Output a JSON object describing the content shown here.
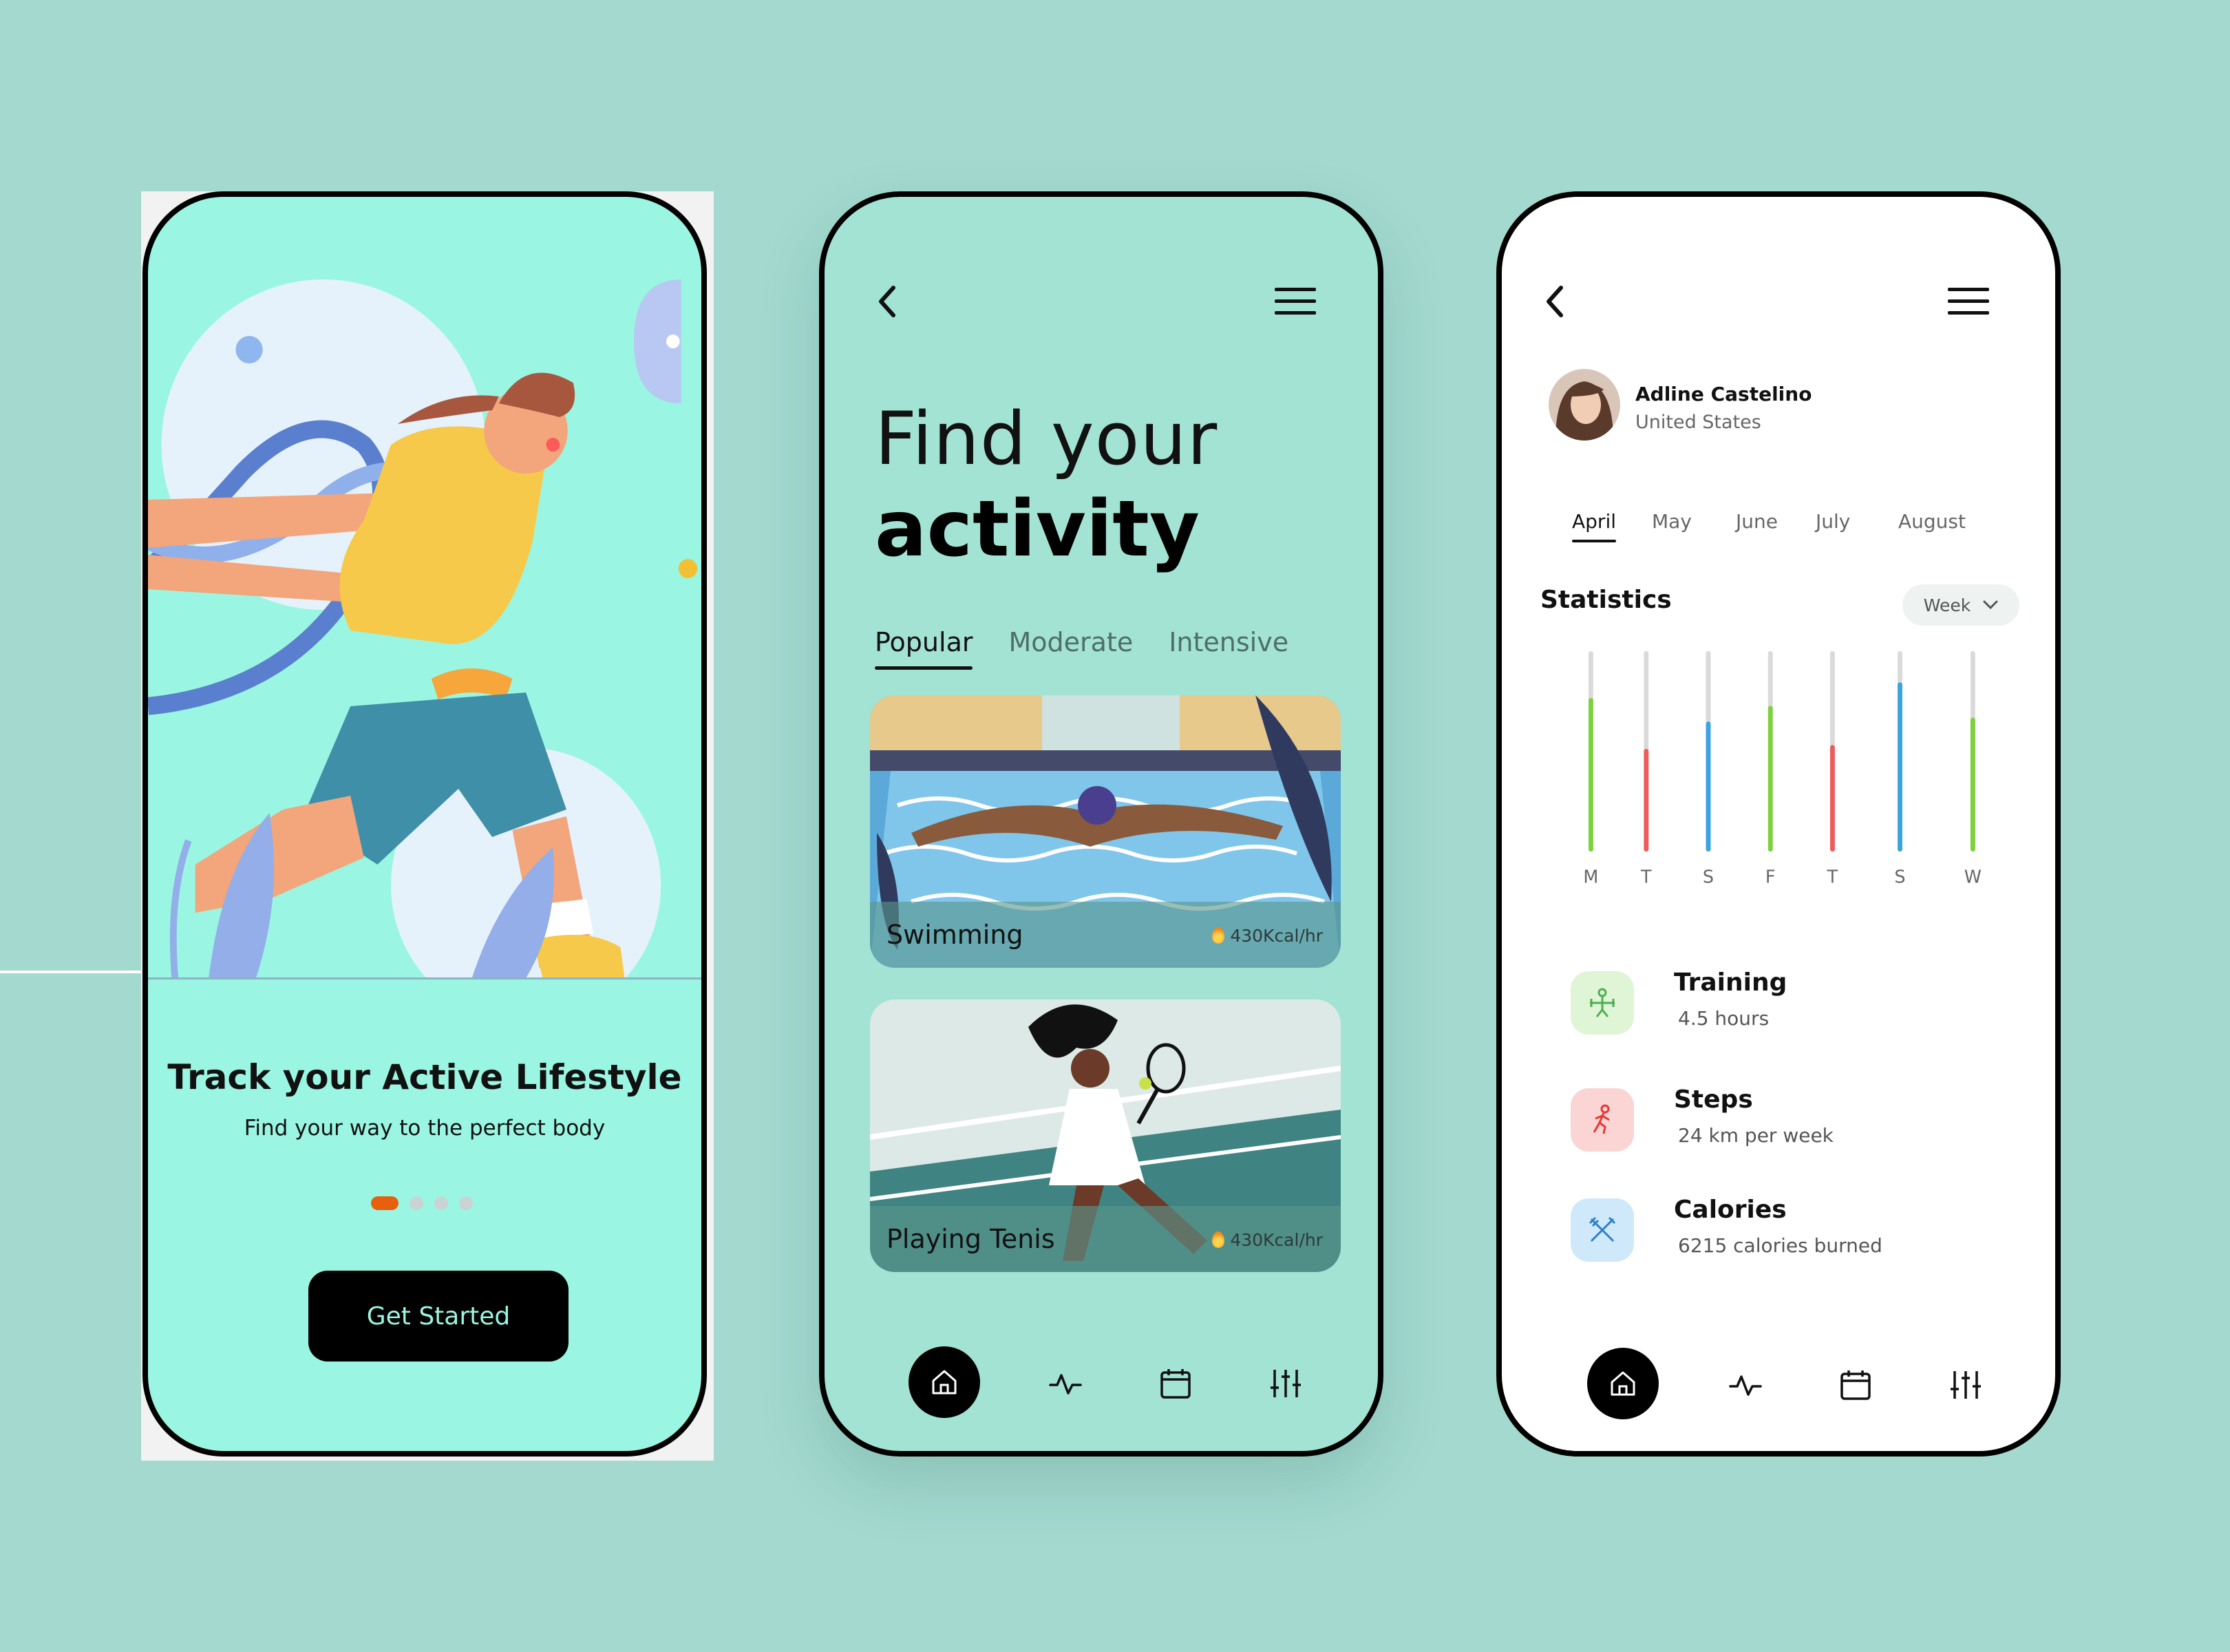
{
  "screen1": {
    "title": "Track your Active Lifestyle",
    "subtitle": "Find your way to the perfect body",
    "button": "Get Started",
    "dots_total": 4,
    "dots_active": 1
  },
  "screen2": {
    "title_line1": "Find your",
    "title_line2": "activity",
    "tabs": [
      {
        "label": "Popular",
        "active": true
      },
      {
        "label": "Moderate",
        "active": false
      },
      {
        "label": "Intensive",
        "active": false
      }
    ],
    "cards": [
      {
        "label": "Swimming",
        "kcal": "430Kcal/hr"
      },
      {
        "label": "Playing Tenis",
        "kcal": "430Kcal/hr"
      }
    ]
  },
  "screen3": {
    "user": {
      "name": "Adline Castelino",
      "location": "United States"
    },
    "months": [
      {
        "label": "April",
        "active": true
      },
      {
        "label": "May",
        "active": false
      },
      {
        "label": "June",
        "active": false
      },
      {
        "label": "July",
        "active": false
      },
      {
        "label": "August",
        "active": false
      }
    ],
    "statistics_title": "Statistics",
    "period_select": "Week",
    "bars": [
      {
        "day": "M",
        "fill": 0.76,
        "color": "#7dd13b"
      },
      {
        "day": "T",
        "fill": 0.5,
        "color": "#ef5b5b"
      },
      {
        "day": "S",
        "fill": 0.64,
        "color": "#3ba3e0"
      },
      {
        "day": "F",
        "fill": 0.72,
        "color": "#7dd13b"
      },
      {
        "day": "T",
        "fill": 0.52,
        "color": "#ef5b5b"
      },
      {
        "day": "S",
        "fill": 0.84,
        "color": "#3ba3e0"
      },
      {
        "day": "W",
        "fill": 0.66,
        "color": "#7dd13b"
      }
    ],
    "stats": [
      {
        "title": "Training",
        "sub": "4.5 hours",
        "icon": "training-icon",
        "bg": "#dff5d6",
        "fg": "#4caf50"
      },
      {
        "title": "Steps",
        "sub": "24 km per week",
        "icon": "running-icon",
        "bg": "#fbd4d4",
        "fg": "#e53935"
      },
      {
        "title": "Calories",
        "sub": "6215 calories burned",
        "icon": "cutlery-icon",
        "bg": "#cfe9fb",
        "fg": "#2f80c9"
      }
    ]
  },
  "colors": {
    "background": "#a3d9cf",
    "phone1": "#9af6e2",
    "phone2": "#a2e3d4",
    "accent_orange": "#e8600d"
  }
}
